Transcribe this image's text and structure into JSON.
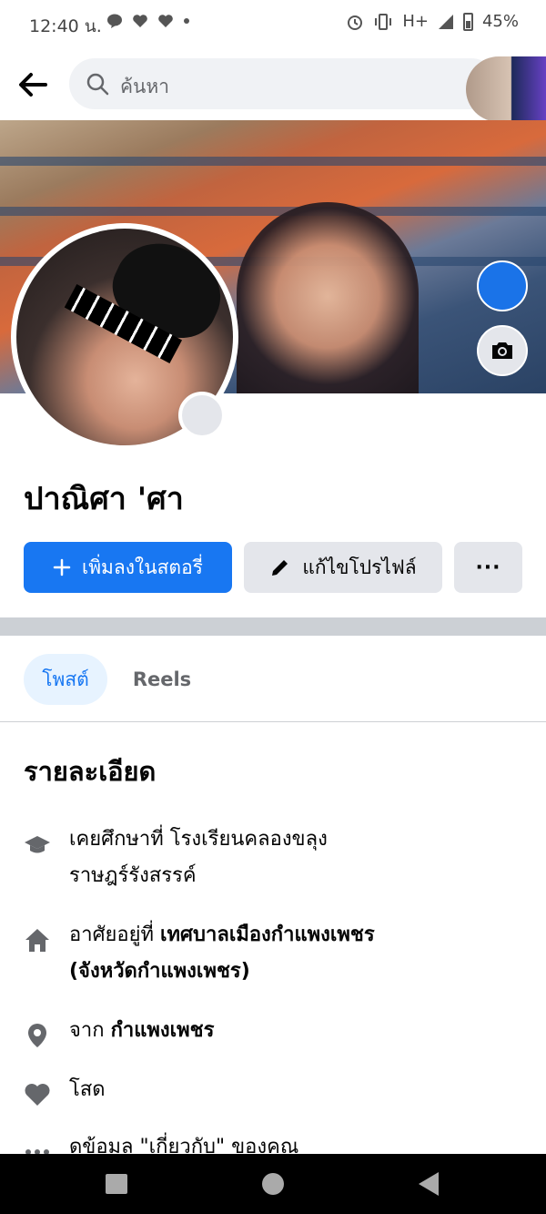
{
  "status_bar": {
    "time": "12:40 น.",
    "network": "H+",
    "battery": "45%"
  },
  "header": {
    "search_placeholder": "ค้นหา"
  },
  "profile": {
    "name": "ปาณิศา 'ศา"
  },
  "actions": {
    "add_story": "เพิ่มลงในสตอรี่",
    "edit_profile": "แก้ไขโปรไฟล์",
    "more": "···"
  },
  "tabs": [
    {
      "label": "โพสต์",
      "active": true
    },
    {
      "label": "Reels",
      "active": false
    }
  ],
  "details": {
    "title": "รายละเอียด",
    "education_prefix": "เคยศึกษาที่ โรงเรียนคลองขลุง",
    "education_line2": "ราษฎร์รังสรรค์",
    "lives_prefix": "อาศัยอยู่ที่ ",
    "lives_bold": "เทศบาลเมืองกำแพงเพชร",
    "lives_bold_line2": "(จังหวัดกำแพงเพชร)",
    "from_prefix": "จาก ",
    "from_bold": "กำแพงเพชร",
    "relationship": "โสด",
    "about_link": "ดูข้อมูล \"เกี่ยวกับ\" ของคุณ"
  },
  "colors": {
    "primary": "#1877f2",
    "button_gray": "#e4e6eb",
    "icon_gray": "#65676b"
  }
}
